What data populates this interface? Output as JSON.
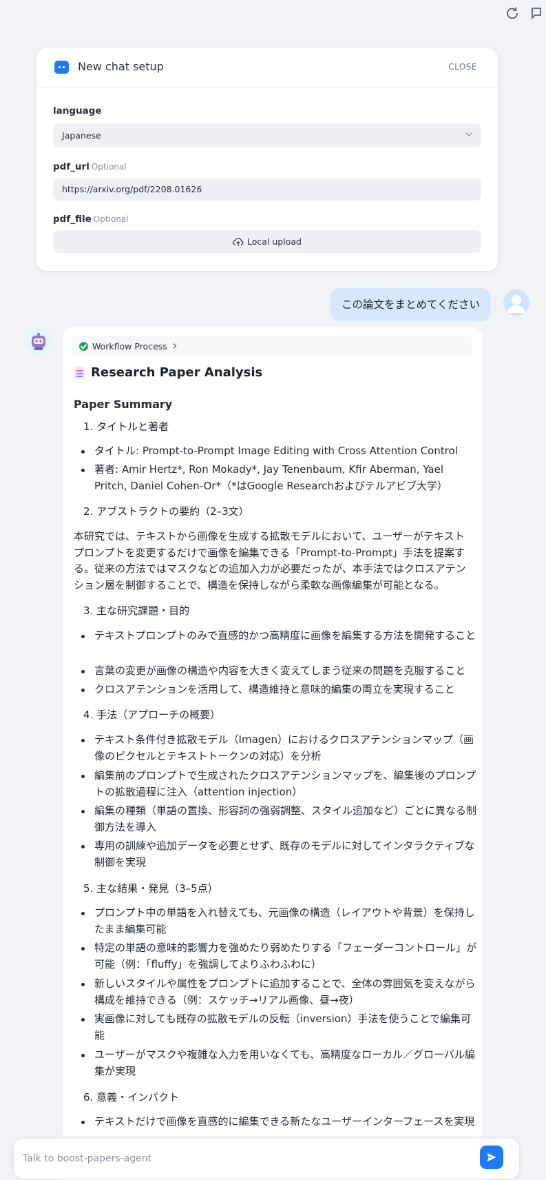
{
  "setup": {
    "title": "New chat setup",
    "close_label": "CLOSE",
    "language_label": "language",
    "language_value": "Japanese",
    "pdf_url_label": "pdf_url",
    "optional_label": "Optional",
    "pdf_url_value": "https://arxiv.org/pdf/2208.01626",
    "pdf_file_label": "pdf_file",
    "upload_label": "Local upload"
  },
  "user_message": "この論文をまとめてください",
  "answer": {
    "workflow_label": "Workflow Process",
    "title": "Research Paper Analysis",
    "summary_heading": "Paper Summary",
    "s1": "タイトルと著者",
    "s1_b1": "タイトル: Prompt-to-Prompt Image Editing with Cross Attention Control",
    "s1_b2": "著者: Amir Hertz*, Ron Mokady*, Jay Tenenbaum, Kfir Aberman, Yael Pritch, Daniel Cohen-Or*（*はGoogle Researchおよびテルアビブ大学）",
    "s2": "アブストラクトの要約（2–3文）",
    "s2_para": "本研究では、テキストから画像を生成する拡散モデルにおいて、ユーザーがテキストプロンプトを変更するだけで画像を編集できる「Prompt-to-Prompt」手法を提案する。従来の方法ではマスクなどの追加入力が必要だったが、本手法ではクロスアテンション層を制御することで、構造を保持しながら柔軟な画像編集が可能となる。",
    "s3": "主な研究課題・目的",
    "s3_b1": "テキストプロンプトのみで直感的かつ高精度に画像を編集する方法を開発すること",
    "s3_b2": "言葉の変更が画像の構造や内容を大きく変えてしまう従来の問題を克服すること",
    "s3_b3": "クロスアテンションを活用して、構造維持と意味的編集の両立を実現すること",
    "s4": "手法（アプローチの概要）",
    "s4_b1": "テキスト条件付き拡散モデル（Imagen）におけるクロスアテンションマップ（画像のピクセルとテキストトークンの対応）を分析",
    "s4_b2": "編集前のプロンプトで生成されたクロスアテンションマップを、編集後のプロンプトの拡散過程に注入（attention injection）",
    "s4_b3": "編集の種類（単語の置換、形容詞の強弱調整、スタイル追加など）ごとに異なる制御方法を導入",
    "s4_b4": "専用の訓練や追加データを必要とせず、既存のモデルに対してインタラクティブな制御を実現",
    "s5": "主な結果・発見（3–5点）",
    "s5_b1": "プロンプト中の単語を入れ替えても、元画像の構造（レイアウトや背景）を保持したまま編集可能",
    "s5_b2": "特定の単語の意味的影響力を強めたり弱めたりする「フェーダーコントロール」が可能（例：「fluffy」を強調してよりふわふわに）",
    "s5_b3": "新しいスタイルや属性をプロンプトに追加することで、全体の雰囲気を変えながら構成を維持できる（例：スケッチ→リアル画像、昼→夜）",
    "s5_b4": "実画像に対しても既存の拡散モデルの反転（inversion）手法を使うことで編集可能",
    "s5_b5": "ユーザーがマスクや複雑な入力を用いなくても、高精度なローカル／グローバル編集が実現",
    "s6": "意義・インパクト",
    "s6_b1": "テキストだけで画像を直感的に編集できる新たなユーザーインターフェースを実現"
  },
  "composer": {
    "placeholder": "Talk to boost-papers-agent"
  }
}
